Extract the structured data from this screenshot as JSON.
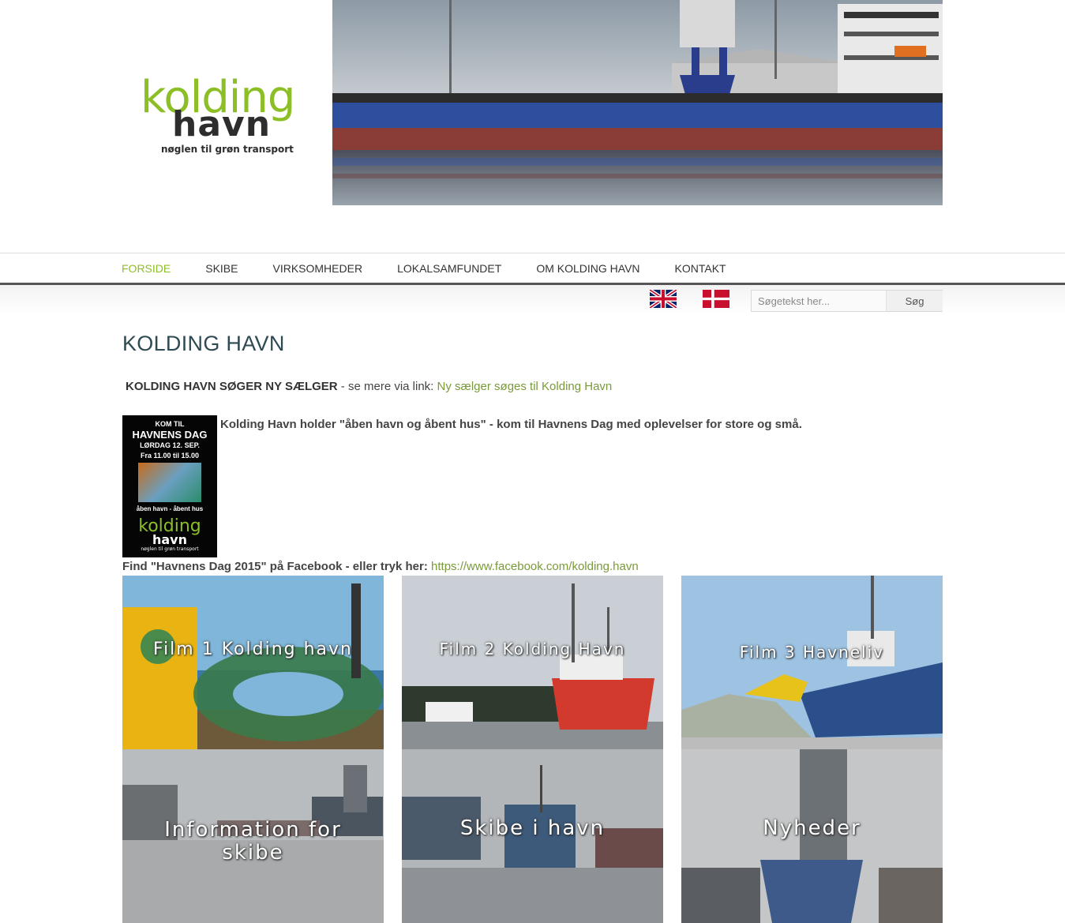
{
  "logo": {
    "line1": "kolding",
    "line2": "havn",
    "tagline": "nøglen til grøn transport"
  },
  "nav": {
    "items": [
      {
        "label": "FORSIDE",
        "active": true
      },
      {
        "label": "SKIBE"
      },
      {
        "label": "VIRKSOMHEDER"
      },
      {
        "label": "LOKALSAMFUNDET"
      },
      {
        "label": "OM KOLDING HAVN"
      },
      {
        "label": "KONTAKT"
      }
    ]
  },
  "languages": [
    {
      "name": "english-flag-icon"
    },
    {
      "name": "danish-flag-icon"
    }
  ],
  "search": {
    "placeholder": "Søgetekst her...",
    "button_label": "Søg"
  },
  "content": {
    "title": "KOLDING HAVN",
    "notice_bold": "KOLDING HAVN SØGER NY SÆLGER",
    "notice_text": " - se mere via link: ",
    "notice_link": "Ny sælger søges til Kolding Havn",
    "poster": {
      "line1": "KOM TIL",
      "line2": "HAVNENS DAG",
      "line3": "LØRDAG 12. SEP.",
      "line4": "Fra 11.00 til 15.00",
      "line5": "åben havn - åbent hus",
      "logo1": "kolding",
      "logo2": "havn",
      "logo3": "nøglen til grøn transport"
    },
    "event_text": "Kolding Havn holder \"åben havn og åbent hus\" - kom til Havnens Dag med oplevelser for store og små.",
    "fb_text": "Find \"Havnens Dag 2015\" på Facebook - eller tryk her: ",
    "fb_link": "https://www.facebook.com/kolding.havn"
  },
  "tiles": [
    {
      "caption": "Film 1 Kolding havn"
    },
    {
      "caption": "Film 2 Kolding Havn"
    },
    {
      "caption": "Film 3 Havneliv"
    },
    {
      "caption_line1": "Information for",
      "caption_line2": "skibe"
    },
    {
      "caption": "Skibe i havn"
    },
    {
      "caption": "Nyheder"
    }
  ],
  "colors": {
    "accent": "#8cbf26",
    "link": "#7a9a3a",
    "title": "#2e4a52",
    "nav_border": "#555555"
  }
}
